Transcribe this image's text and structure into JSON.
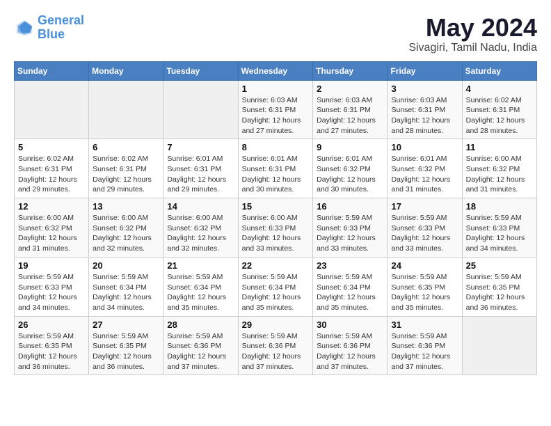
{
  "logo": {
    "line1": "General",
    "line2": "Blue"
  },
  "title": "May 2024",
  "location": "Sivagiri, Tamil Nadu, India",
  "days_header": [
    "Sunday",
    "Monday",
    "Tuesday",
    "Wednesday",
    "Thursday",
    "Friday",
    "Saturday"
  ],
  "weeks": [
    [
      {
        "day": "",
        "info": ""
      },
      {
        "day": "",
        "info": ""
      },
      {
        "day": "",
        "info": ""
      },
      {
        "day": "1",
        "info": "Sunrise: 6:03 AM\nSunset: 6:31 PM\nDaylight: 12 hours\nand 27 minutes."
      },
      {
        "day": "2",
        "info": "Sunrise: 6:03 AM\nSunset: 6:31 PM\nDaylight: 12 hours\nand 27 minutes."
      },
      {
        "day": "3",
        "info": "Sunrise: 6:03 AM\nSunset: 6:31 PM\nDaylight: 12 hours\nand 28 minutes."
      },
      {
        "day": "4",
        "info": "Sunrise: 6:02 AM\nSunset: 6:31 PM\nDaylight: 12 hours\nand 28 minutes."
      }
    ],
    [
      {
        "day": "5",
        "info": "Sunrise: 6:02 AM\nSunset: 6:31 PM\nDaylight: 12 hours\nand 29 minutes."
      },
      {
        "day": "6",
        "info": "Sunrise: 6:02 AM\nSunset: 6:31 PM\nDaylight: 12 hours\nand 29 minutes."
      },
      {
        "day": "7",
        "info": "Sunrise: 6:01 AM\nSunset: 6:31 PM\nDaylight: 12 hours\nand 29 minutes."
      },
      {
        "day": "8",
        "info": "Sunrise: 6:01 AM\nSunset: 6:31 PM\nDaylight: 12 hours\nand 30 minutes."
      },
      {
        "day": "9",
        "info": "Sunrise: 6:01 AM\nSunset: 6:32 PM\nDaylight: 12 hours\nand 30 minutes."
      },
      {
        "day": "10",
        "info": "Sunrise: 6:01 AM\nSunset: 6:32 PM\nDaylight: 12 hours\nand 31 minutes."
      },
      {
        "day": "11",
        "info": "Sunrise: 6:00 AM\nSunset: 6:32 PM\nDaylight: 12 hours\nand 31 minutes."
      }
    ],
    [
      {
        "day": "12",
        "info": "Sunrise: 6:00 AM\nSunset: 6:32 PM\nDaylight: 12 hours\nand 31 minutes."
      },
      {
        "day": "13",
        "info": "Sunrise: 6:00 AM\nSunset: 6:32 PM\nDaylight: 12 hours\nand 32 minutes."
      },
      {
        "day": "14",
        "info": "Sunrise: 6:00 AM\nSunset: 6:32 PM\nDaylight: 12 hours\nand 32 minutes."
      },
      {
        "day": "15",
        "info": "Sunrise: 6:00 AM\nSunset: 6:33 PM\nDaylight: 12 hours\nand 33 minutes."
      },
      {
        "day": "16",
        "info": "Sunrise: 5:59 AM\nSunset: 6:33 PM\nDaylight: 12 hours\nand 33 minutes."
      },
      {
        "day": "17",
        "info": "Sunrise: 5:59 AM\nSunset: 6:33 PM\nDaylight: 12 hours\nand 33 minutes."
      },
      {
        "day": "18",
        "info": "Sunrise: 5:59 AM\nSunset: 6:33 PM\nDaylight: 12 hours\nand 34 minutes."
      }
    ],
    [
      {
        "day": "19",
        "info": "Sunrise: 5:59 AM\nSunset: 6:33 PM\nDaylight: 12 hours\nand 34 minutes."
      },
      {
        "day": "20",
        "info": "Sunrise: 5:59 AM\nSunset: 6:34 PM\nDaylight: 12 hours\nand 34 minutes."
      },
      {
        "day": "21",
        "info": "Sunrise: 5:59 AM\nSunset: 6:34 PM\nDaylight: 12 hours\nand 35 minutes."
      },
      {
        "day": "22",
        "info": "Sunrise: 5:59 AM\nSunset: 6:34 PM\nDaylight: 12 hours\nand 35 minutes."
      },
      {
        "day": "23",
        "info": "Sunrise: 5:59 AM\nSunset: 6:34 PM\nDaylight: 12 hours\nand 35 minutes."
      },
      {
        "day": "24",
        "info": "Sunrise: 5:59 AM\nSunset: 6:35 PM\nDaylight: 12 hours\nand 35 minutes."
      },
      {
        "day": "25",
        "info": "Sunrise: 5:59 AM\nSunset: 6:35 PM\nDaylight: 12 hours\nand 36 minutes."
      }
    ],
    [
      {
        "day": "26",
        "info": "Sunrise: 5:59 AM\nSunset: 6:35 PM\nDaylight: 12 hours\nand 36 minutes."
      },
      {
        "day": "27",
        "info": "Sunrise: 5:59 AM\nSunset: 6:35 PM\nDaylight: 12 hours\nand 36 minutes."
      },
      {
        "day": "28",
        "info": "Sunrise: 5:59 AM\nSunset: 6:36 PM\nDaylight: 12 hours\nand 37 minutes."
      },
      {
        "day": "29",
        "info": "Sunrise: 5:59 AM\nSunset: 6:36 PM\nDaylight: 12 hours\nand 37 minutes."
      },
      {
        "day": "30",
        "info": "Sunrise: 5:59 AM\nSunset: 6:36 PM\nDaylight: 12 hours\nand 37 minutes."
      },
      {
        "day": "31",
        "info": "Sunrise: 5:59 AM\nSunset: 6:36 PM\nDaylight: 12 hours\nand 37 minutes."
      },
      {
        "day": "",
        "info": ""
      }
    ]
  ]
}
